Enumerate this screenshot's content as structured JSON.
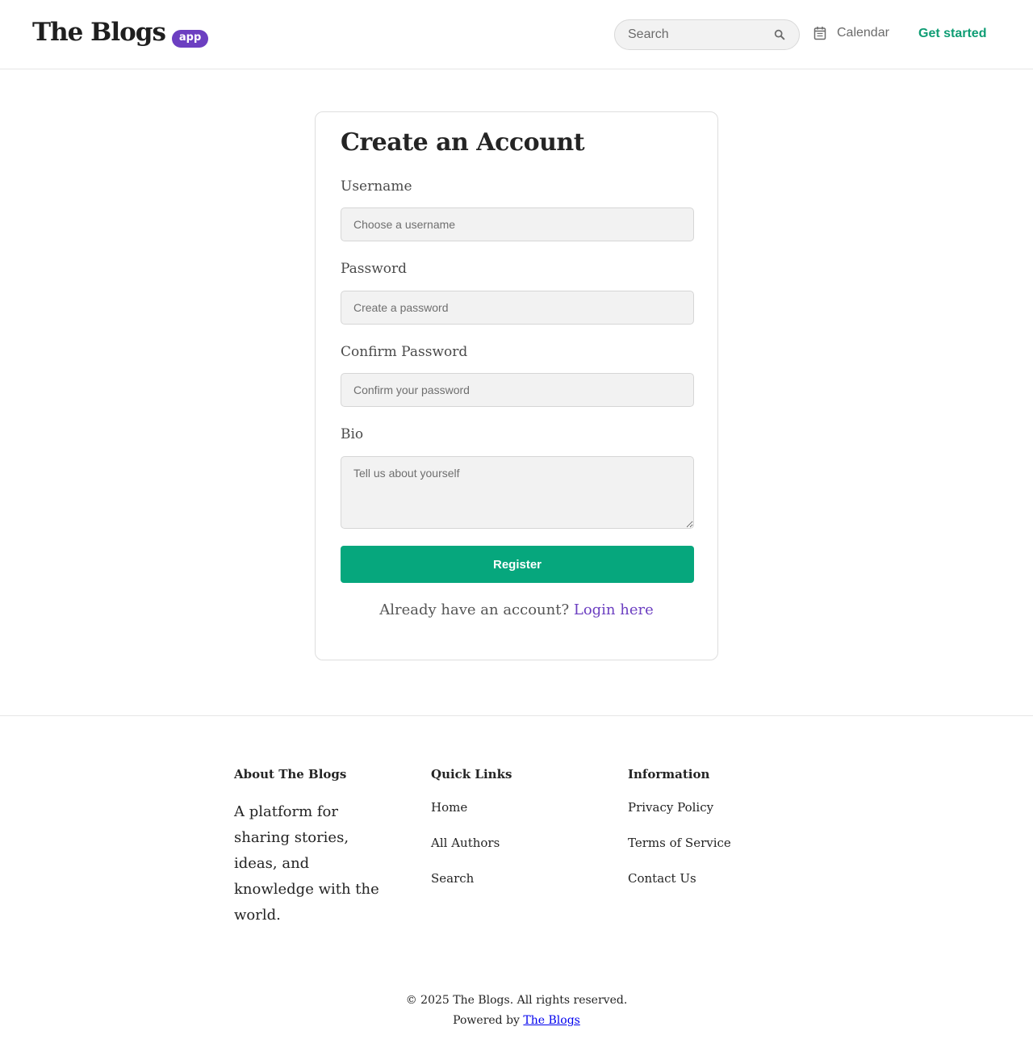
{
  "header": {
    "logo_text": "The Blogs",
    "logo_badge": "app",
    "search_placeholder": "Search",
    "calendar_label": "Calendar",
    "get_started_label": "Get started"
  },
  "form": {
    "title": "Create an Account",
    "username_label": "Username",
    "username_placeholder": "Choose a username",
    "password_label": "Password",
    "password_placeholder": "Create a password",
    "confirm_label": "Confirm Password",
    "confirm_placeholder": "Confirm your password",
    "bio_label": "Bio",
    "bio_placeholder": "Tell us about yourself",
    "register_label": "Register",
    "login_prompt": "Already have an account?",
    "login_link": "Login here"
  },
  "footer": {
    "about_title": "About The Blogs",
    "about_text": "A platform for sharing stories, ideas, and knowledge with the world.",
    "quick_title": "Quick Links",
    "quick_links": [
      "Home",
      "All Authors",
      "Search"
    ],
    "info_title": "Information",
    "info_links": [
      "Privacy Policy",
      "Terms of Service",
      "Contact Us"
    ],
    "copyright": "© 2025 The Blogs. All rights reserved.",
    "powered_prefix": "Powered by",
    "powered_link": "The Blogs"
  },
  "colors": {
    "accent_green": "#06a77d",
    "brand_purple": "#6c3fc1"
  }
}
